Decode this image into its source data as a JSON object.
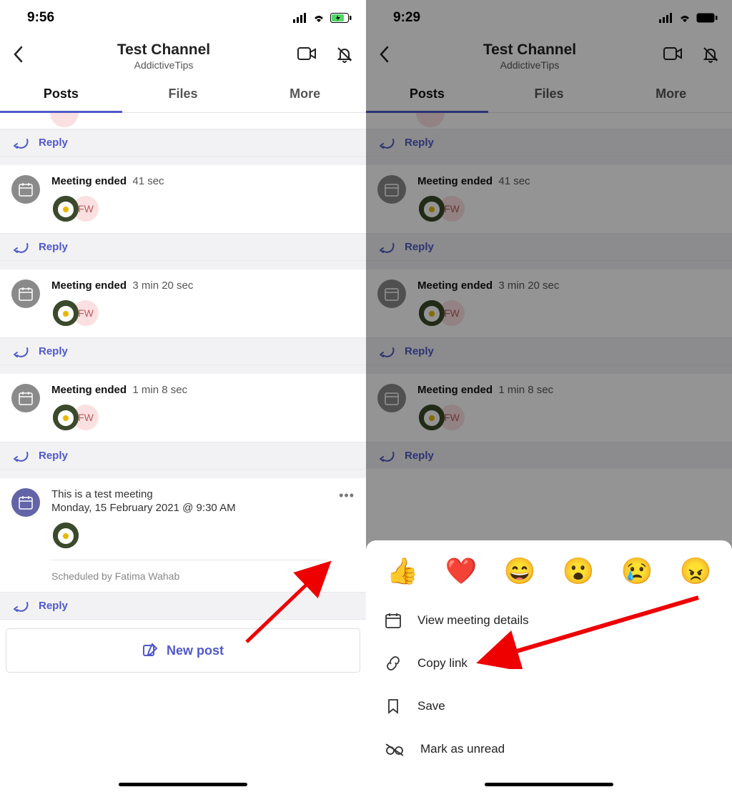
{
  "left": {
    "status_time": "9:56",
    "title": "Test Channel",
    "subtitle": "AddictiveTips",
    "tabs": {
      "posts": "Posts",
      "files": "Files",
      "more": "More"
    },
    "reply": "Reply",
    "fw": "FW",
    "posts": {
      "m1": {
        "label": "Meeting ended",
        "dur": "41 sec"
      },
      "m2": {
        "label": "Meeting ended",
        "dur": "3 min 20 sec"
      },
      "m3": {
        "label": "Meeting ended",
        "dur": "1 min 8 sec"
      },
      "meet": {
        "title": "This is a test meeting",
        "date": "Monday, 15 February 2021 @ 9:30 AM",
        "scheduled": "Scheduled by Fatima Wahab"
      }
    },
    "composer": "New post"
  },
  "right": {
    "status_time": "9:29",
    "title": "Test Channel",
    "subtitle": "AddictiveTips",
    "tabs": {
      "posts": "Posts",
      "files": "Files",
      "more": "More"
    },
    "reply": "Reply",
    "fw": "FW",
    "posts": {
      "m1": {
        "label": "Meeting ended",
        "dur": "41 sec"
      },
      "m2": {
        "label": "Meeting ended",
        "dur": "3 min 20 sec"
      },
      "m3": {
        "label": "Meeting ended",
        "dur": "1 min 8 sec"
      }
    },
    "reactions": {
      "thumb": "👍",
      "heart": "❤️",
      "laugh": "😄",
      "surprise": "😮",
      "sad": "😢",
      "angry": "😠"
    },
    "menu": {
      "view": "View meeting details",
      "copy": "Copy link",
      "save": "Save",
      "unread": "Mark as unread"
    }
  }
}
